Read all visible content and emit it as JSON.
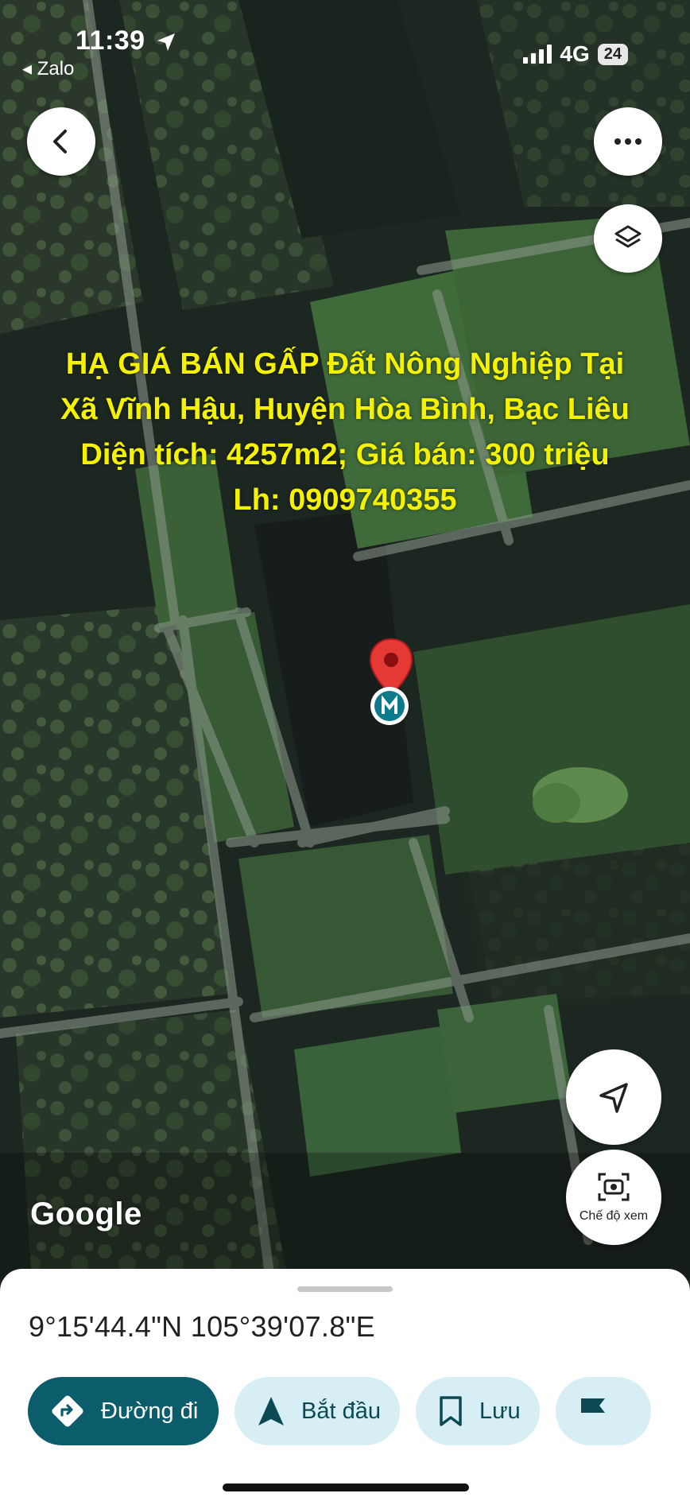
{
  "status_bar": {
    "time": "11:39",
    "back_app": "◂ Zalo",
    "network": "4G",
    "battery": "24"
  },
  "listing_overlay": {
    "line1": "HẠ GIÁ BÁN GẤP Đất Nông Nghiệp Tại",
    "line2": "Xã Vĩnh Hậu, Huyện Hòa Bình, Bạc Liêu",
    "line3": "Diện tích: 4257m2; Giá bán: 300 triệu",
    "line4": "Lh: 0909740355",
    "color": "#f5f200"
  },
  "map": {
    "attribution": "Google",
    "view_mode_label": "Chế độ xem",
    "marker_color": "#e53935"
  },
  "bottom_sheet": {
    "coordinates": "9°15'44.4\"N 105°39'07.8\"E",
    "actions": [
      {
        "label": "Đường đi",
        "icon": "directions-icon"
      },
      {
        "label": "Bắt đầu",
        "icon": "navigation-arrow-icon"
      },
      {
        "label": "Lưu",
        "icon": "bookmark-icon"
      },
      {
        "label": "",
        "icon": "flag-icon"
      }
    ]
  },
  "colors": {
    "primary_button": "#0b5d6b",
    "secondary_button": "#d7eff4"
  }
}
